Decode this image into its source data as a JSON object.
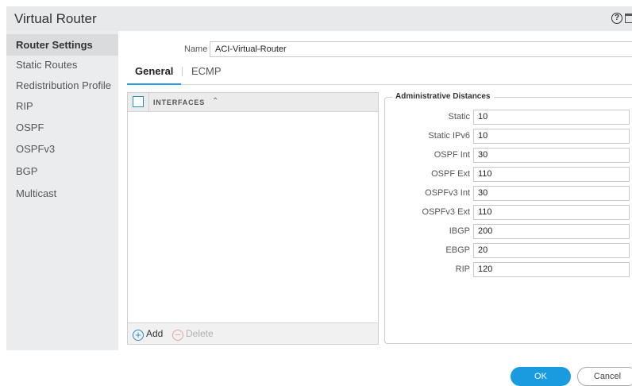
{
  "window": {
    "title": "Virtual Router",
    "help_icon": "help-icon",
    "maximize_icon": "maximize-icon"
  },
  "sidebar": {
    "items": [
      {
        "label": "Router Settings",
        "active": true
      },
      {
        "label": "Static Routes",
        "active": false
      },
      {
        "label": "Redistribution Profile",
        "active": false
      },
      {
        "label": "RIP",
        "active": false
      },
      {
        "label": "OSPF",
        "active": false
      },
      {
        "label": "OSPFv3",
        "active": false
      },
      {
        "label": "BGP",
        "active": false
      },
      {
        "label": "Multicast",
        "active": false
      }
    ]
  },
  "name_field": {
    "label": "Name",
    "value": "ACI-Virtual-Router"
  },
  "tabs": [
    {
      "label": "General",
      "active": true
    },
    {
      "label": "ECMP",
      "active": false
    }
  ],
  "interfaces": {
    "column_header": "INTERFACES",
    "sort_icon": "chevron-up-icon",
    "rows": [],
    "add_label": "Add",
    "delete_label": "Delete",
    "add_icon": "plus-circle-icon",
    "delete_icon": "minus-circle-icon"
  },
  "admin_distances": {
    "title": "Administrative Distances",
    "rows": [
      {
        "label": "Static",
        "value": "10"
      },
      {
        "label": "Static IPv6",
        "value": "10"
      },
      {
        "label": "OSPF Int",
        "value": "30"
      },
      {
        "label": "OSPF Ext",
        "value": "110"
      },
      {
        "label": "OSPFv3 Int",
        "value": "30"
      },
      {
        "label": "OSPFv3 Ext",
        "value": "110"
      },
      {
        "label": "IBGP",
        "value": "200"
      },
      {
        "label": "EBGP",
        "value": "20"
      },
      {
        "label": "RIP",
        "value": "120"
      }
    ]
  },
  "footer": {
    "ok_label": "OK",
    "cancel_label": "Cancel"
  },
  "colors": {
    "accent": "#1a9be0",
    "delete_disabled": "#e8a3a3"
  }
}
